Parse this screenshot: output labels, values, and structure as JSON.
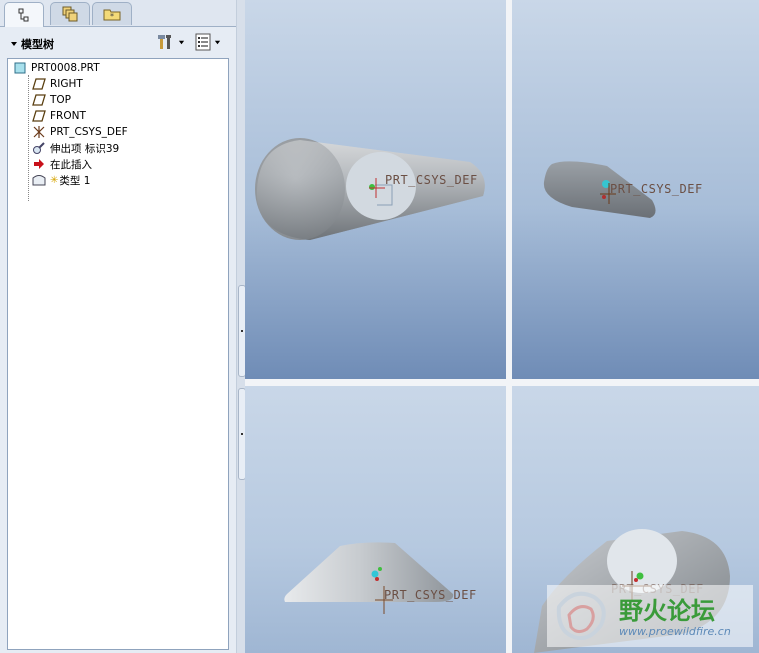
{
  "tabs": [
    {
      "name": "model-tree-tab-icon"
    },
    {
      "name": "layers-tab-icon"
    },
    {
      "name": "folder-browser-tab-icon"
    }
  ],
  "panel": {
    "title": "模型树"
  },
  "tree": {
    "root": "PRT0008.PRT",
    "items": [
      {
        "label": "RIGHT",
        "icon": "datum-plane-icon"
      },
      {
        "label": "TOP",
        "icon": "datum-plane-icon"
      },
      {
        "label": "FRONT",
        "icon": "datum-plane-icon"
      },
      {
        "label": "PRT_CSYS_DEF",
        "icon": "coordinate-system-icon"
      },
      {
        "label": "伸出项 标识39",
        "icon": "extrude-feature-icon"
      },
      {
        "label": "在此插入",
        "icon": "insert-here-arrow-icon"
      },
      {
        "label": "类型 1",
        "icon": "view-type-icon"
      }
    ]
  },
  "viewports": {
    "csys_label": "PRT_CSYS_DEF"
  },
  "watermark": {
    "title": "野火论坛",
    "url": "www.proewildfire.cn"
  },
  "colors": {
    "viewport_top": "#c9d7e8",
    "viewport_bottom": "#6f8cb6",
    "model_grey": "#b8bcc0",
    "csys_label": "#6b4f44",
    "watermark_green": "#3a9b3a"
  }
}
